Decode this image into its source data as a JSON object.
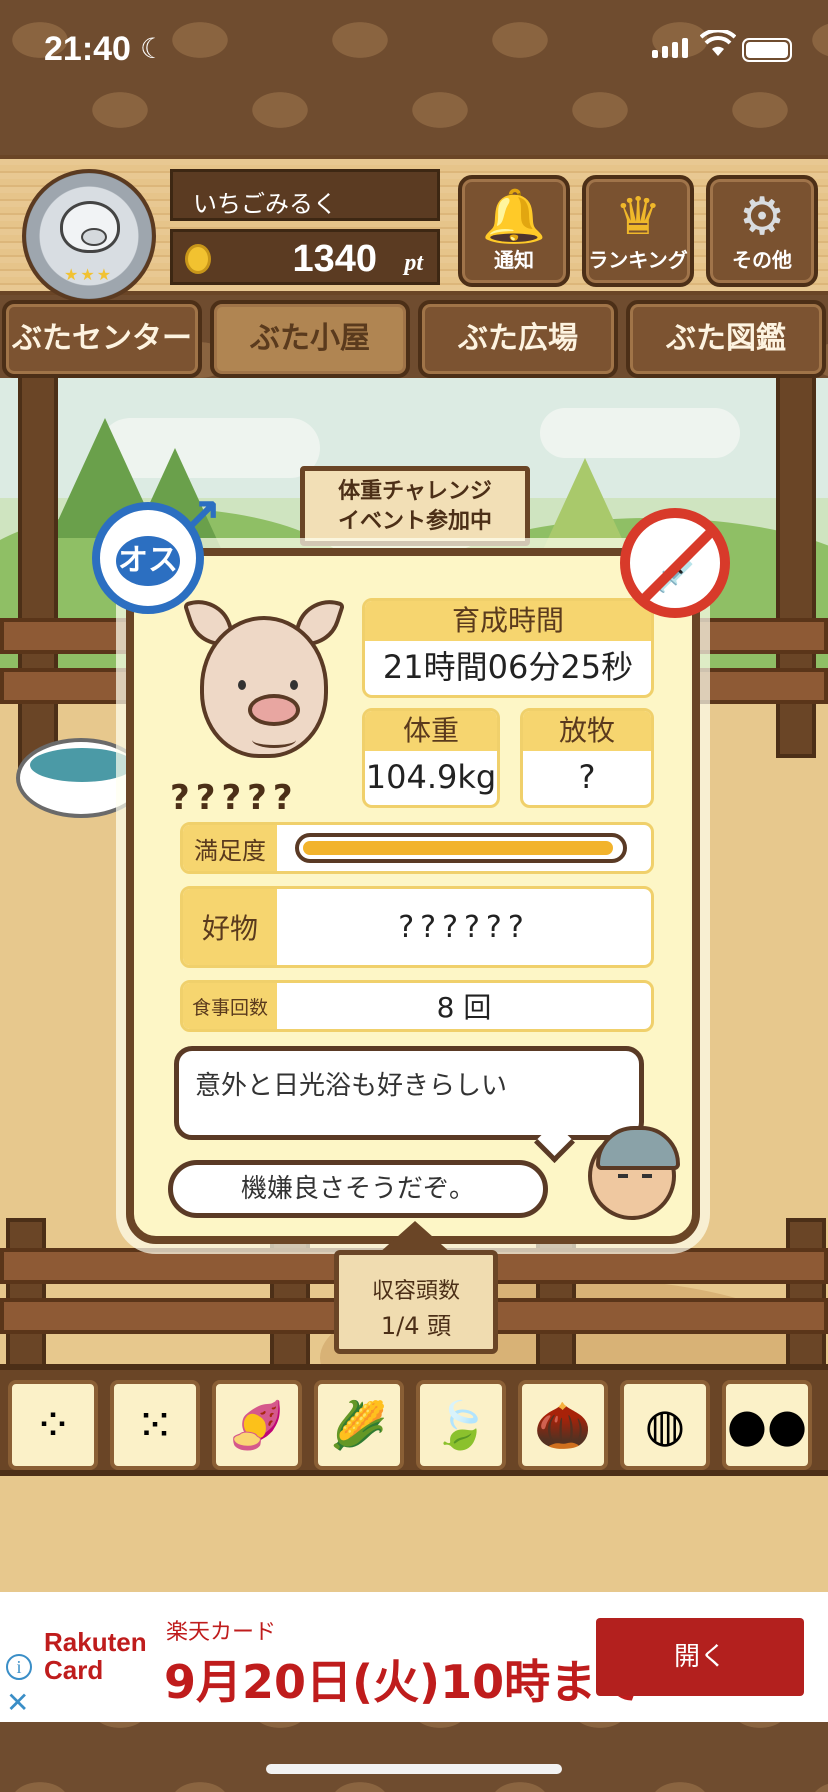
{
  "status_bar": {
    "time": "21:40"
  },
  "header": {
    "player_name": "いちごみるく",
    "points": "1340",
    "points_unit": "pt",
    "buttons": [
      {
        "label": "通知",
        "icon": "bell-icon"
      },
      {
        "label": "ランキング",
        "icon": "crown-icon"
      },
      {
        "label": "その他",
        "icon": "gear-icon"
      }
    ]
  },
  "tabs": [
    {
      "label": "ぶたセンター"
    },
    {
      "label": "ぶた小屋",
      "active": true
    },
    {
      "label": "ぶた広場"
    },
    {
      "label": "ぶた図鑑"
    }
  ],
  "event_sign": {
    "line1": "体重チャレンジ",
    "line2": "イベント参加中"
  },
  "pig_card": {
    "gender_label": "オス",
    "name": "?????",
    "rearing_time_label": "育成時間",
    "rearing_time": "21時間06分25秒",
    "weight_label": "体重",
    "weight": "104.9kg",
    "grazing_label": "放牧",
    "grazing": "?",
    "satisfaction_label": "満足度",
    "satisfaction_level": 0.98,
    "favorite_label": "好物",
    "favorite": "??????",
    "meals_label": "食事回数",
    "meals": "8 回",
    "comment": "意外と日光浴も好きらしい",
    "farmer_speech": "機嫌良さそうだぞ。"
  },
  "capacity": {
    "label": "収容頭数",
    "value": "1/4 頭"
  },
  "food_items": [
    {
      "icon": "grain-pile-icon"
    },
    {
      "icon": "mixed-grain-icon"
    },
    {
      "icon": "sweet-potato-icon"
    },
    {
      "icon": "corn-icon"
    },
    {
      "icon": "leaf-berries-icon"
    },
    {
      "icon": "acorn-icon"
    },
    {
      "icon": "soybean-plate-icon"
    },
    {
      "icon": "dumpling-plate-icon"
    }
  ],
  "ad": {
    "brand": "Rakuten Card",
    "subtitle": "楽天カード",
    "headline": "9月20日(火)10時まで",
    "button": "開く"
  }
}
